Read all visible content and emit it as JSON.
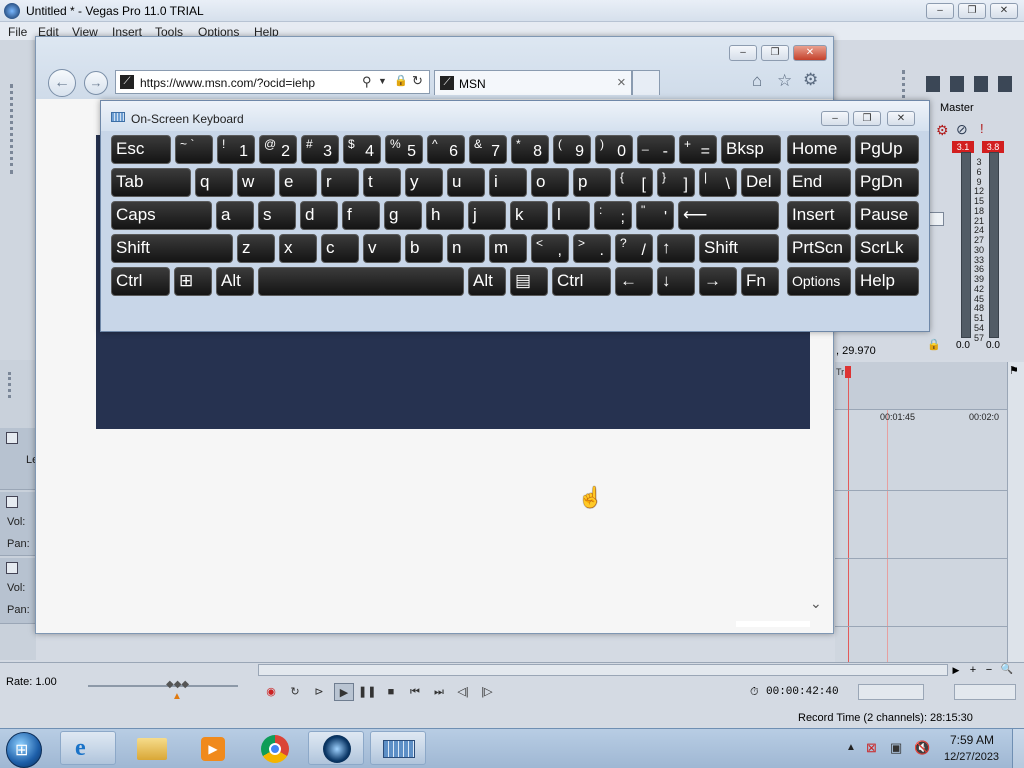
{
  "vegas": {
    "title": "Untitled * - Vegas Pro 11.0 TRIAL",
    "menu": [
      "File",
      "Edit",
      "View",
      "Insert",
      "Tools",
      "Options",
      "Help"
    ],
    "master_label": "Master",
    "peak_left": "3.1",
    "peak_right": "3.8",
    "meter_scale": [
      "3",
      "6",
      "9",
      "12",
      "15",
      "18",
      "21",
      "24",
      "27",
      "30",
      "33",
      "36",
      "39",
      "42",
      "45",
      "48",
      "51",
      "54",
      "57"
    ],
    "meter_bottom_left": "0.0",
    "meter_bottom_right": "0.0",
    "position_readout": ", 29.970",
    "timeline_ticks": [
      "00:01:45",
      "00:02:0"
    ],
    "tracks": [
      {
        "label": "Le"
      },
      {
        "vol": "Vol:",
        "pan": "Pan:"
      },
      {
        "vol": "Vol:",
        "pan": "Pan:"
      }
    ],
    "rate": "Rate: 1.00",
    "time_readout": "00:00:42:40",
    "record_time": "Record Time (2 channels): 28:15:30",
    "window_buttons": [
      "–",
      "❐",
      "✕"
    ]
  },
  "ie": {
    "address": "https://www.msn.com/?ocid=iehp",
    "tab_label": "MSN",
    "tab_close": "×",
    "nav_back": "←",
    "nav_forward": "→"
  },
  "osk": {
    "title": "On-Screen Keyboard",
    "rows": [
      [
        {
          "label": "Esc",
          "w": 60
        },
        {
          "small": "~ `",
          "w": 38
        },
        {
          "small": "!",
          "big": "1",
          "w": 38
        },
        {
          "small": "@",
          "big": "2",
          "w": 38
        },
        {
          "small": "#",
          "big": "3",
          "w": 38
        },
        {
          "small": "$",
          "big": "4",
          "w": 38
        },
        {
          "small": "%",
          "big": "5",
          "w": 38
        },
        {
          "small": "^",
          "big": "6",
          "w": 38
        },
        {
          "small": "&",
          "big": "7",
          "w": 38
        },
        {
          "small": "*",
          "big": "8",
          "w": 38
        },
        {
          "small": "(",
          "big": "9",
          "w": 38
        },
        {
          "small": ")",
          "big": "0",
          "w": 38
        },
        {
          "small": "_",
          "big": "-",
          "w": 38
        },
        {
          "small": "+",
          "big": "=",
          "w": 38
        },
        {
          "label": "Bksp",
          "w": 60
        }
      ],
      [
        {
          "label": "Tab",
          "w": 80
        },
        {
          "label": "q",
          "w": 38
        },
        {
          "label": "w",
          "w": 38
        },
        {
          "label": "e",
          "w": 38
        },
        {
          "label": "r",
          "w": 38
        },
        {
          "label": "t",
          "w": 38
        },
        {
          "label": "y",
          "w": 38
        },
        {
          "label": "u",
          "w": 38
        },
        {
          "label": "i",
          "w": 38
        },
        {
          "label": "o",
          "w": 38
        },
        {
          "label": "p",
          "w": 38
        },
        {
          "small": "{",
          "big": "[",
          "w": 38
        },
        {
          "small": "}",
          "big": "]",
          "w": 38
        },
        {
          "small": "|",
          "big": "\\",
          "w": 38
        },
        {
          "label": "Del",
          "w": 40
        }
      ],
      [
        {
          "label": "Caps",
          "w": 101
        },
        {
          "label": "a",
          "w": 38
        },
        {
          "label": "s",
          "w": 38
        },
        {
          "label": "d",
          "w": 38
        },
        {
          "label": "f",
          "w": 38
        },
        {
          "label": "g",
          "w": 38
        },
        {
          "label": "h",
          "w": 38
        },
        {
          "label": "j",
          "w": 38
        },
        {
          "label": "k",
          "w": 38
        },
        {
          "label": "l",
          "w": 38
        },
        {
          "small": ":",
          "big": ";",
          "w": 38
        },
        {
          "small": "\"",
          "big": "'",
          "w": 38
        },
        {
          "label": "⟵",
          "w": 101
        }
      ],
      [
        {
          "label": "Shift",
          "w": 122
        },
        {
          "label": "z",
          "w": 38
        },
        {
          "label": "x",
          "w": 38
        },
        {
          "label": "c",
          "w": 38
        },
        {
          "label": "v",
          "w": 38
        },
        {
          "label": "b",
          "w": 38
        },
        {
          "label": "n",
          "w": 38
        },
        {
          "label": "m",
          "w": 38
        },
        {
          "small": "<",
          "big": ",",
          "w": 38
        },
        {
          "small": ">",
          "big": ".",
          "w": 38
        },
        {
          "small": "?",
          "big": "/",
          "w": 38
        },
        {
          "label": "↑",
          "w": 38
        },
        {
          "label": "Shift",
          "w": 80
        }
      ],
      [
        {
          "label": "Ctrl",
          "w": 59
        },
        {
          "label": "⊞",
          "w": 38
        },
        {
          "label": "Alt",
          "w": 38
        },
        {
          "label": "",
          "w": 206
        },
        {
          "label": "Alt",
          "w": 38
        },
        {
          "label": "▤",
          "w": 38
        },
        {
          "label": "Ctrl",
          "w": 59
        },
        {
          "label": "←",
          "w": 38
        },
        {
          "label": "↓",
          "w": 38
        },
        {
          "label": "→",
          "w": 38
        },
        {
          "label": "Fn",
          "w": 38
        }
      ]
    ],
    "side_rows": [
      [
        "Home",
        "PgUp"
      ],
      [
        "End",
        "PgDn"
      ],
      [
        "Insert",
        "Pause"
      ],
      [
        "PrtScn",
        "ScrLk"
      ],
      [
        "Options",
        "Help"
      ]
    ]
  },
  "taskbar": {
    "time": "7:59 AM",
    "date": "12/27/2023"
  }
}
